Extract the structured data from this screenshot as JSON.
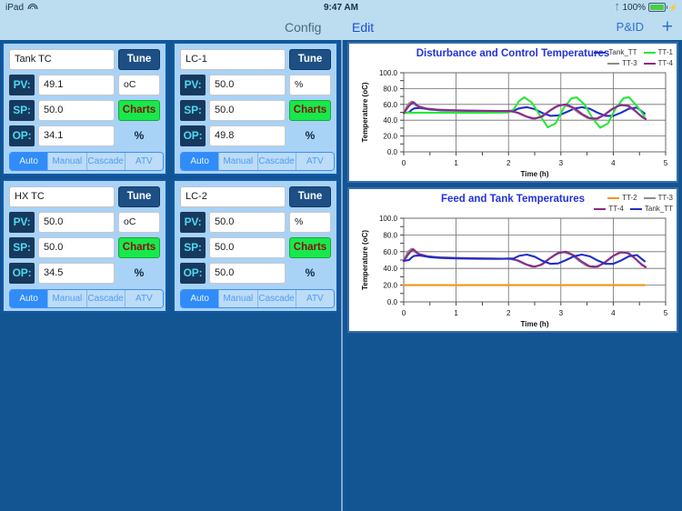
{
  "statusbar": {
    "device": "iPad",
    "wifi_icon": "wifi-icon",
    "time": "9:47 AM",
    "bluetooth_icon": "bluetooth-icon",
    "battery_percent": "100%",
    "battery_icon": "battery-charging-icon"
  },
  "navbar": {
    "config_label": "Config",
    "edit_label": "Edit",
    "pid_label": "P&ID",
    "add_label": "+"
  },
  "controllers": [
    {
      "tag": "Tank TC",
      "tune_label": "Tune",
      "pv_label": "PV:",
      "pv_value": "49.1",
      "pv_unit": "oC",
      "sp_label": "SP:",
      "sp_value": "50.0",
      "charts_label": "Charts",
      "op_label": "OP:",
      "op_value": "34.1",
      "op_unit": "%",
      "modes": [
        "Auto",
        "Manual",
        "Cascade",
        "ATV"
      ],
      "active_mode": "Auto"
    },
    {
      "tag": "LC-1",
      "tune_label": "Tune",
      "pv_label": "PV:",
      "pv_value": "50.0",
      "pv_unit": "%",
      "sp_label": "SP:",
      "sp_value": "50.0",
      "charts_label": "Charts",
      "op_label": "OP:",
      "op_value": "49.8",
      "op_unit": "%",
      "modes": [
        "Auto",
        "Manual",
        "Cascade",
        "ATV"
      ],
      "active_mode": "Auto"
    },
    {
      "tag": "HX TC",
      "tune_label": "Tune",
      "pv_label": "PV:",
      "pv_value": "50.0",
      "pv_unit": "oC",
      "sp_label": "SP:",
      "sp_value": "50.0",
      "charts_label": "Charts",
      "op_label": "OP:",
      "op_value": "34.5",
      "op_unit": "%",
      "modes": [
        "Auto",
        "Manual",
        "Cascade",
        "ATV"
      ],
      "active_mode": "Auto"
    },
    {
      "tag": "LC-2",
      "tune_label": "Tune",
      "pv_label": "PV:",
      "pv_value": "50.0",
      "pv_unit": "%",
      "sp_label": "SP:",
      "sp_value": "50.0",
      "charts_label": "Charts",
      "op_label": "OP:",
      "op_value": "50.0",
      "op_unit": "%",
      "modes": [
        "Auto",
        "Manual",
        "Cascade",
        "ATV"
      ],
      "active_mode": "Auto"
    }
  ],
  "chart_data": [
    {
      "type": "line",
      "title": "Disturbance and Control Temperatures",
      "xlabel": "Time (h)",
      "ylabel": "Temperature (oC)",
      "xlim": [
        0,
        5
      ],
      "ylim": [
        0,
        100
      ],
      "xticks": [
        "0",
        "1",
        "2",
        "3",
        "4",
        "5"
      ],
      "yticks": [
        "0.0",
        "20.0",
        "40.0",
        "60.0",
        "80.0",
        "100.0"
      ],
      "grid": true,
      "legend_position": "top-right",
      "series": [
        {
          "name": "Tank_TT",
          "color": "#1f2fc8",
          "x": [
            0.0,
            0.1,
            0.15,
            0.2,
            0.3,
            0.4,
            0.5,
            0.7,
            1.0,
            1.4,
            1.8,
            2.1,
            2.2,
            2.35,
            2.5,
            2.65,
            2.8,
            2.95,
            3.1,
            3.25,
            3.4,
            3.55,
            3.7,
            3.85,
            4.0,
            4.15,
            4.3,
            4.45,
            4.6
          ],
          "y": [
            49.0,
            50.0,
            53.0,
            55.0,
            55.5,
            54.5,
            53.5,
            52.5,
            52.0,
            51.6,
            51.4,
            52.0,
            55.0,
            56.5,
            54.0,
            49.0,
            45.5,
            46.0,
            50.0,
            54.5,
            56.5,
            54.5,
            49.5,
            45.5,
            45.5,
            49.5,
            54.5,
            56.0,
            48.5
          ]
        },
        {
          "name": "TT-1",
          "color": "#25e839",
          "x": [
            0.0,
            0.1,
            0.2,
            0.4,
            0.8,
            1.2,
            1.6,
            2.0,
            2.1,
            2.2,
            2.3,
            2.45,
            2.6,
            2.75,
            2.9,
            3.05,
            3.2,
            3.3,
            3.45,
            3.6,
            3.75,
            3.9,
            4.05,
            4.2,
            4.3,
            4.45,
            4.6
          ],
          "y": [
            49.0,
            49.5,
            49.5,
            49.5,
            49.5,
            49.5,
            49.5,
            49.7,
            54.0,
            64.0,
            69.0,
            62.0,
            46.0,
            31.0,
            36.0,
            55.0,
            67.5,
            69.0,
            60.0,
            43.0,
            30.5,
            36.0,
            55.5,
            68.0,
            69.0,
            58.0,
            45.0
          ]
        },
        {
          "name": "TT-3",
          "color": "#8c8c8c",
          "x": [
            0.0,
            0.08,
            0.15,
            0.25,
            0.4,
            0.6,
            1.0,
            1.5,
            2.0,
            2.15,
            2.3,
            2.45,
            2.6,
            2.75,
            2.9,
            3.05,
            3.2,
            3.35,
            3.5,
            3.65,
            3.8,
            3.95,
            4.1,
            4.25,
            4.4,
            4.5,
            4.6
          ],
          "y": [
            49.0,
            60.0,
            63.5,
            58.0,
            55.0,
            53.5,
            52.5,
            51.8,
            51.5,
            50.0,
            45.5,
            42.0,
            43.5,
            50.5,
            57.0,
            59.5,
            56.5,
            49.0,
            43.0,
            41.5,
            45.5,
            53.0,
            58.5,
            59.0,
            53.0,
            47.0,
            42.5
          ]
        },
        {
          "name": "TT-4",
          "color": "#8b2a8b",
          "x": [
            0.0,
            0.1,
            0.18,
            0.28,
            0.45,
            0.7,
            1.1,
            1.6,
            2.05,
            2.2,
            2.35,
            2.5,
            2.65,
            2.8,
            2.95,
            3.1,
            3.25,
            3.4,
            3.55,
            3.7,
            3.85,
            4.0,
            4.15,
            4.3,
            4.45,
            4.55,
            4.62
          ],
          "y": [
            49.0,
            58.0,
            63.0,
            57.5,
            54.5,
            53.0,
            52.3,
            51.8,
            51.5,
            49.0,
            44.5,
            42.0,
            45.0,
            52.5,
            58.5,
            60.0,
            55.5,
            48.0,
            42.5,
            42.0,
            47.5,
            55.0,
            59.5,
            58.0,
            50.0,
            44.0,
            41.5
          ]
        }
      ]
    },
    {
      "type": "line",
      "title": "Feed and Tank Temperatures",
      "xlabel": "Time (h)",
      "ylabel": "Temperature (oC)",
      "xlim": [
        0,
        5
      ],
      "ylim": [
        0,
        100
      ],
      "xticks": [
        "0",
        "1",
        "2",
        "3",
        "4",
        "5"
      ],
      "yticks": [
        "0.0",
        "20.0",
        "40.0",
        "60.0",
        "80.0",
        "100.0"
      ],
      "grid": true,
      "legend_position": "top-right",
      "series": [
        {
          "name": "TT-2",
          "color": "#f59314",
          "x": [
            0.0,
            1.0,
            2.0,
            3.0,
            4.0,
            4.6
          ],
          "y": [
            20.0,
            20.0,
            20.0,
            20.0,
            20.0,
            20.0
          ]
        },
        {
          "name": "TT-3",
          "color": "#8c8c8c",
          "x": [
            0.0,
            0.08,
            0.15,
            0.25,
            0.4,
            0.6,
            1.0,
            1.5,
            2.0,
            2.15,
            2.3,
            2.45,
            2.6,
            2.75,
            2.9,
            3.05,
            3.2,
            3.35,
            3.5,
            3.65,
            3.8,
            3.95,
            4.1,
            4.25,
            4.4,
            4.5,
            4.6
          ],
          "y": [
            49.0,
            60.0,
            63.5,
            58.0,
            55.0,
            53.5,
            52.5,
            51.8,
            51.5,
            50.0,
            45.5,
            42.0,
            43.5,
            50.5,
            57.0,
            59.5,
            56.5,
            49.0,
            43.0,
            41.5,
            45.5,
            53.0,
            58.5,
            59.0,
            53.0,
            47.0,
            42.5
          ]
        },
        {
          "name": "TT-4",
          "color": "#8b2a8b",
          "x": [
            0.0,
            0.1,
            0.18,
            0.28,
            0.45,
            0.7,
            1.1,
            1.6,
            2.05,
            2.2,
            2.35,
            2.5,
            2.65,
            2.8,
            2.95,
            3.1,
            3.25,
            3.4,
            3.55,
            3.7,
            3.85,
            4.0,
            4.15,
            4.3,
            4.45,
            4.55,
            4.62
          ],
          "y": [
            49.0,
            58.0,
            63.0,
            57.5,
            54.5,
            53.0,
            52.3,
            51.8,
            51.5,
            49.0,
            44.5,
            42.0,
            45.0,
            52.5,
            58.5,
            60.0,
            55.5,
            48.0,
            42.5,
            42.0,
            47.5,
            55.0,
            59.5,
            58.0,
            50.0,
            44.0,
            41.5
          ]
        },
        {
          "name": "Tank_TT",
          "color": "#1f2fc8",
          "x": [
            0.0,
            0.1,
            0.15,
            0.2,
            0.3,
            0.4,
            0.5,
            0.7,
            1.0,
            1.4,
            1.8,
            2.1,
            2.2,
            2.35,
            2.5,
            2.65,
            2.8,
            2.95,
            3.1,
            3.25,
            3.4,
            3.55,
            3.7,
            3.85,
            4.0,
            4.15,
            4.3,
            4.45,
            4.6
          ],
          "y": [
            49.0,
            50.0,
            53.0,
            55.0,
            55.5,
            54.5,
            53.5,
            52.5,
            52.0,
            51.6,
            51.4,
            52.0,
            55.0,
            56.5,
            54.0,
            49.0,
            45.5,
            46.0,
            50.0,
            54.5,
            56.5,
            54.5,
            49.5,
            45.5,
            45.5,
            49.5,
            54.5,
            56.0,
            48.5
          ]
        }
      ]
    }
  ]
}
